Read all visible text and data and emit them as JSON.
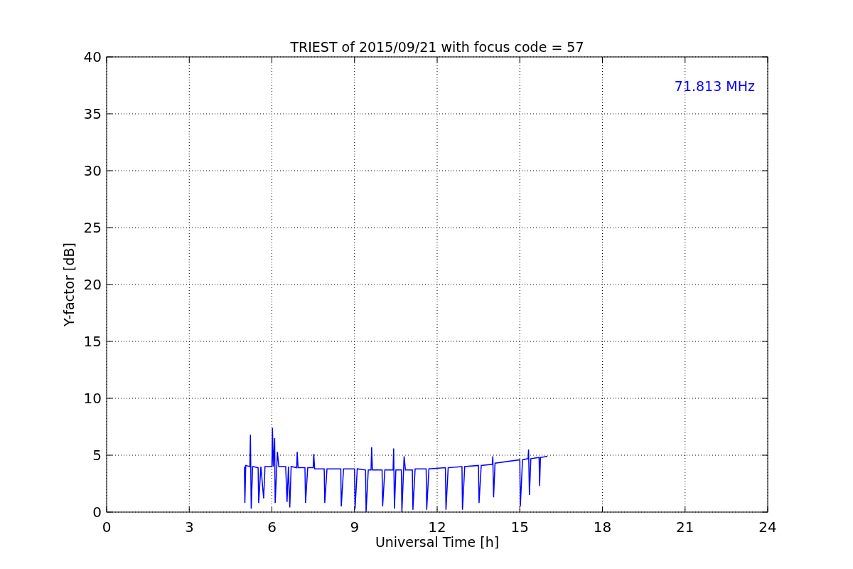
{
  "figure": {
    "chart_data": {
      "type": "line",
      "title": "TRIEST of 2015/09/21 with focus code = 57",
      "xlabel": "Universal Time [h]",
      "ylabel": "Y-factor [dB]",
      "xlim": [
        0,
        24
      ],
      "ylim": [
        0,
        40
      ],
      "xticks": [
        0,
        3,
        6,
        9,
        12,
        15,
        18,
        21,
        24
      ],
      "yticks": [
        0,
        5,
        10,
        15,
        20,
        25,
        30,
        35,
        40
      ],
      "x": [
        5.0,
        5.02,
        5.05,
        5.2,
        5.22,
        5.25,
        5.3,
        5.5,
        5.52,
        5.6,
        5.7,
        5.75,
        6.0,
        6.02,
        6.05,
        6.1,
        6.12,
        6.2,
        6.25,
        6.5,
        6.55,
        6.6,
        6.65,
        6.7,
        6.9,
        6.92,
        6.95,
        7.2,
        7.22,
        7.3,
        7.5,
        7.52,
        7.55,
        7.9,
        7.92,
        8.0,
        8.5,
        8.52,
        8.6,
        9.0,
        9.02,
        9.1,
        9.4,
        9.42,
        9.5,
        9.6,
        9.62,
        9.65,
        10.0,
        10.02,
        10.1,
        10.4,
        10.42,
        10.45,
        10.5,
        10.7,
        10.72,
        10.8,
        10.85,
        11.1,
        11.12,
        11.2,
        11.6,
        11.62,
        11.7,
        12.3,
        12.32,
        12.4,
        12.9,
        12.92,
        13.0,
        13.5,
        13.52,
        13.6,
        14.0,
        14.02,
        14.05,
        14.1,
        15.0,
        15.02,
        15.1,
        15.3,
        15.32,
        15.35,
        15.4,
        15.7,
        15.72,
        15.75,
        16.0
      ],
      "series": [
        {
          "name": "71.813 MHz",
          "color": "#0000ff",
          "values": [
            4.0,
            0.8,
            4.1,
            4.0,
            6.8,
            0.3,
            4.0,
            3.9,
            0.8,
            4.0,
            1.2,
            4.0,
            4.0,
            7.4,
            4.0,
            6.5,
            0.8,
            5.3,
            4.0,
            4.0,
            0.9,
            4.0,
            0.4,
            4.0,
            3.9,
            5.3,
            3.9,
            3.9,
            0.8,
            3.9,
            3.9,
            5.1,
            3.8,
            3.8,
            0.8,
            3.8,
            3.8,
            0.5,
            3.8,
            3.8,
            0.3,
            3.8,
            3.7,
            0.0,
            3.7,
            3.7,
            5.7,
            3.7,
            3.7,
            0.5,
            3.7,
            3.7,
            5.6,
            0.3,
            3.7,
            3.7,
            0.0,
            4.9,
            3.7,
            3.7,
            0.2,
            3.8,
            3.8,
            0.2,
            3.8,
            3.9,
            0.2,
            3.9,
            4.0,
            0.2,
            4.0,
            4.1,
            0.8,
            4.1,
            4.2,
            4.9,
            1.3,
            4.3,
            4.6,
            0.5,
            4.6,
            4.7,
            5.5,
            1.5,
            4.7,
            4.8,
            2.3,
            4.8,
            4.9
          ]
        }
      ],
      "grid": true
    }
  }
}
